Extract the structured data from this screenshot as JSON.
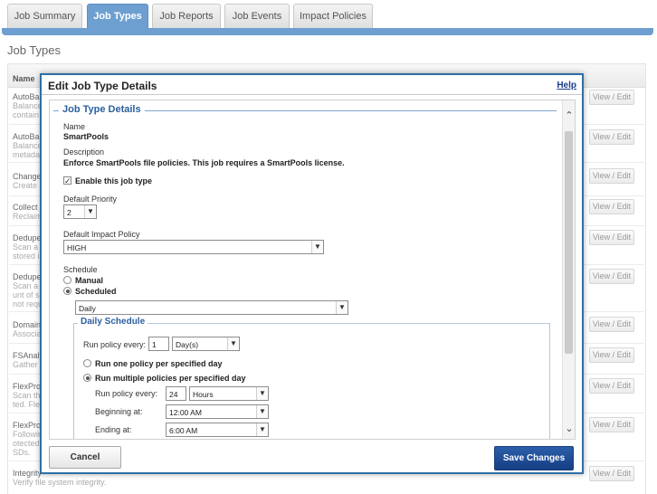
{
  "tabs": [
    {
      "label": "Job Summary",
      "active": false
    },
    {
      "label": "Job Types",
      "active": true
    },
    {
      "label": "Job Reports",
      "active": false
    },
    {
      "label": "Job Events",
      "active": false
    },
    {
      "label": "Impact Policies",
      "active": false
    }
  ],
  "page": {
    "title": "Job Types",
    "table_header_name": "Name",
    "rows": [
      {
        "name": "AutoBal",
        "desc": [
          "Balance",
          "contain"
        ],
        "action": "View / Edit"
      },
      {
        "name": "AutoBal",
        "desc": [
          "Balance",
          "metadat"
        ],
        "action": "View / Edit"
      },
      {
        "name": "Change",
        "desc": [
          "Create a"
        ],
        "action": "View / Edit"
      },
      {
        "name": "Collect",
        "desc": [
          "Reclaim"
        ],
        "action": "View / Edit"
      },
      {
        "name": "Dedupe",
        "desc": [
          "Scan a",
          "stored in"
        ],
        "action": "View / Edit"
      },
      {
        "name": "Dedupe",
        "desc": [
          "Scan a",
          "unt of sp",
          "not requ"
        ],
        "action": "View / Edit"
      },
      {
        "name": "Domain",
        "desc": [
          "Associat"
        ],
        "action": "View / Edit"
      },
      {
        "name": "FSAnaly",
        "desc": [
          "Gather"
        ],
        "action": "View / Edit"
      },
      {
        "name": "FlexProt",
        "desc": [
          "Scan th",
          "ted. Fle"
        ],
        "action": "View / Edit"
      },
      {
        "name": "FlexProt",
        "desc": [
          "Followin",
          "otected.",
          "SDs."
        ],
        "action": "View / Edit"
      },
      {
        "name": "Integrity",
        "desc": [
          "Verify file system integrity."
        ],
        "action": "View / Edit"
      }
    ]
  },
  "modal": {
    "title": "Edit Job Type Details",
    "help": "Help",
    "section_legend": "Job Type Details",
    "name_label": "Name",
    "name_value": "SmartPools",
    "description_label": "Description",
    "description_value": "Enforce SmartPools file policies. This job requires a SmartPools license.",
    "enable_label": "Enable this job type",
    "enable_checked": true,
    "priority_label": "Default Priority",
    "priority_value": "2",
    "impact_label": "Default Impact Policy",
    "impact_value": "HIGH",
    "schedule_label": "Schedule",
    "manual_label": "Manual",
    "scheduled_label": "Scheduled",
    "schedule_select": "Daily",
    "daily": {
      "legend": "Daily Schedule",
      "run_every_label": "Run policy every:",
      "run_every_value": "1",
      "run_every_unit": "Day(s)",
      "run_one_label": "Run one policy per specified day",
      "run_multiple_label": "Run multiple policies per specified day",
      "multi_every_label": "Run policy every:",
      "multi_every_value": "24",
      "multi_every_unit": "Hours",
      "beginning_label": "Beginning at:",
      "beginning_value": "12:00 AM",
      "ending_label": "Ending at:",
      "ending_value": "6:00 AM"
    },
    "cancel": "Cancel",
    "save": "Save Changes"
  },
  "colors": {
    "accent": "#6d9fd0",
    "modal_border": "#2e6fa7",
    "save_button": "#1f4c93",
    "legend": "#2b5f9e"
  },
  "icons": {
    "dropdown": "chevron-down-icon",
    "scroll_up": "chevron-up-icon",
    "scroll_down": "chevron-down-icon",
    "check": "checkmark-icon"
  }
}
